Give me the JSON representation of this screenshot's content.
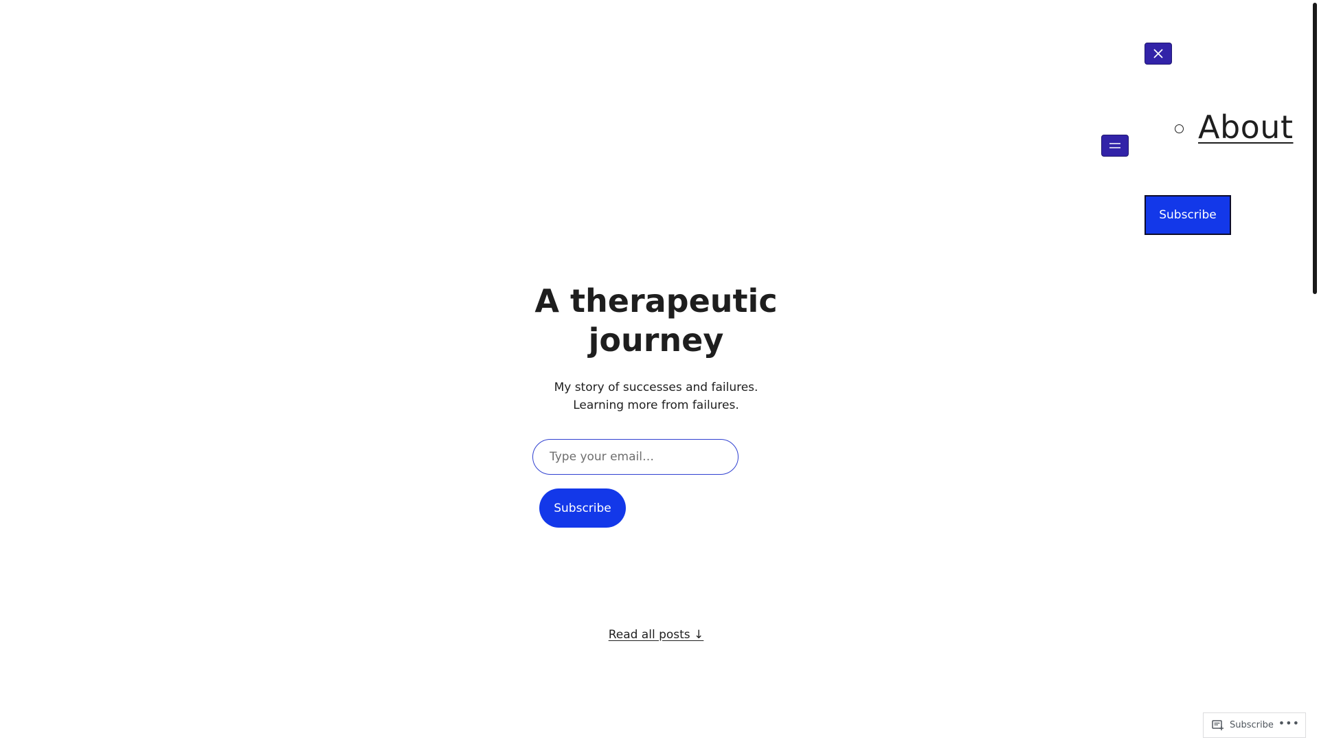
{
  "nav": {
    "close_icon": "close-icon",
    "menu_icon": "menu-icon",
    "items": [
      {
        "label": "About"
      }
    ],
    "subscribe_label": "Subscribe"
  },
  "hero": {
    "title": "A therapeutic journey",
    "description": "My story of successes and failures. Learning more from failures.",
    "email_placeholder": "Type your email…",
    "subscribe_label": "Subscribe"
  },
  "read_all": {
    "label": "Read all posts ↓"
  },
  "action_bar": {
    "subscribe_label": "Subscribe",
    "more_icon": "more-dots-icon"
  },
  "colors": {
    "accent_blue": "#1338e9",
    "nav_button_purple": "#3223a8",
    "text": "#1e1e1e"
  }
}
